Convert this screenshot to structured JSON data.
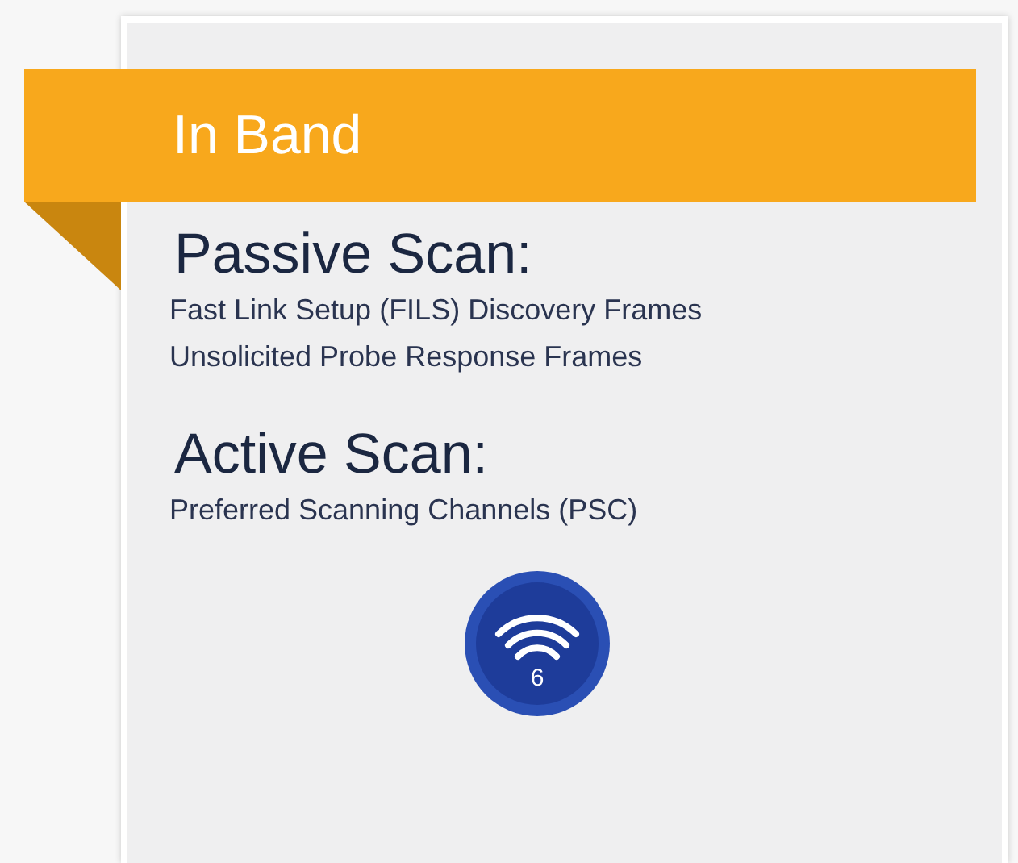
{
  "banner": {
    "title": "In Band"
  },
  "sections": [
    {
      "heading": "Passive Scan:",
      "lines": [
        "Fast Link Setup (FILS) Discovery Frames",
        "Unsolicited Probe Response Frames"
      ]
    },
    {
      "heading": "Active Scan:",
      "lines": [
        "Preferred Scanning Channels (PSC)"
      ]
    }
  ],
  "badge": {
    "label": "6"
  }
}
